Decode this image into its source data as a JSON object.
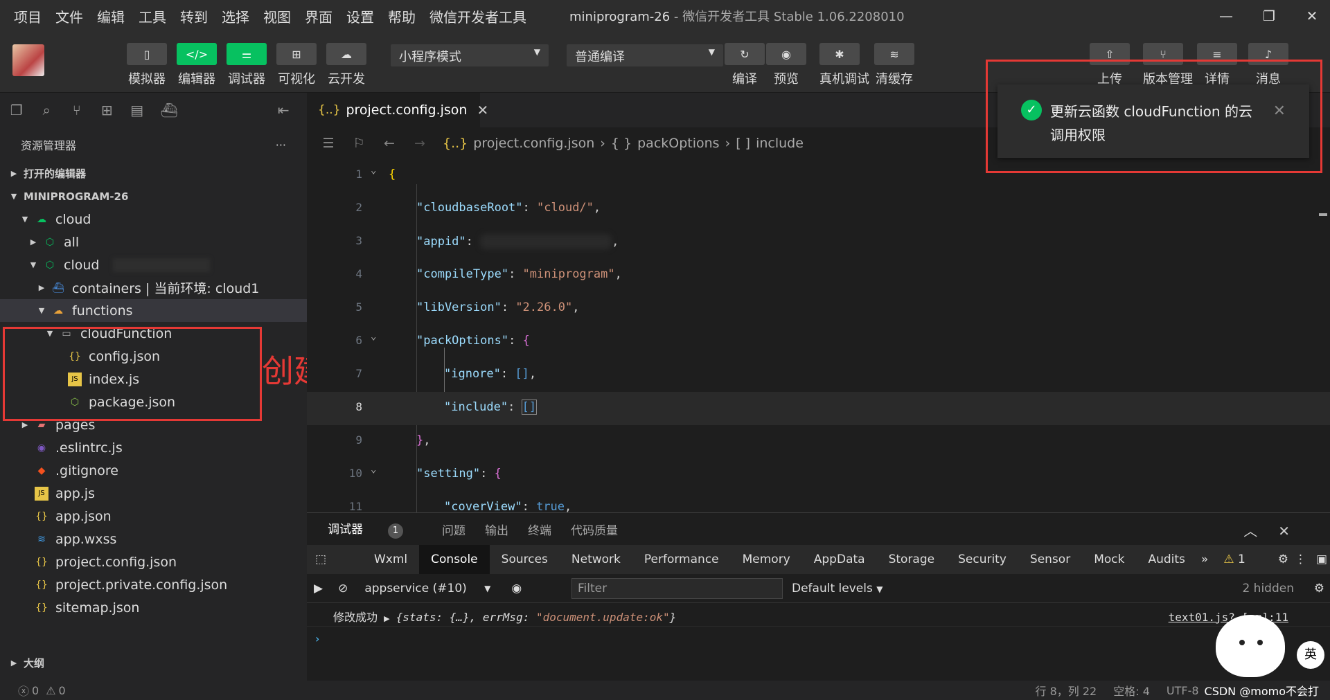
{
  "menubar": {
    "items": [
      "项目",
      "文件",
      "编辑",
      "工具",
      "转到",
      "选择",
      "视图",
      "界面",
      "设置",
      "帮助",
      "微信开发者工具"
    ],
    "title": "miniprogram-26",
    "title_suffix": " - 微信开发者工具 Stable 1.06.2208010"
  },
  "toolbar": {
    "simulator": "模拟器",
    "editor": "编辑器",
    "debugger": "调试器",
    "visual": "可视化",
    "cloud": "云开发",
    "mode_select": "小程序模式",
    "compile_select": "普通编译",
    "compile": "编译",
    "preview": "预览",
    "remote_debug": "真机调试",
    "clear_cache": "清缓存",
    "upload": "上传",
    "version": "版本管理",
    "details": "详情",
    "messages": "消息"
  },
  "sidebar": {
    "title": "资源管理器",
    "more": "···",
    "open_editors": "打开的编辑器",
    "project": "MINIPROGRAM-26",
    "tree": [
      {
        "label": "cloud"
      },
      {
        "label": "all"
      },
      {
        "label": "cloud"
      },
      {
        "label": "containers | 当前环境: cloud1"
      },
      {
        "label": "functions"
      },
      {
        "label": "cloudFunction"
      },
      {
        "label": "config.json"
      },
      {
        "label": "index.js"
      },
      {
        "label": "package.json"
      },
      {
        "label": "pages"
      },
      {
        "label": ".eslintrc.js"
      },
      {
        "label": ".gitignore"
      },
      {
        "label": "app.js"
      },
      {
        "label": "app.json"
      },
      {
        "label": "app.wxss"
      },
      {
        "label": "project.config.json"
      },
      {
        "label": "project.private.config.json"
      },
      {
        "label": "sitemap.json"
      }
    ],
    "outline": "大纲"
  },
  "annotation": "创建node.js云函数",
  "editor": {
    "tab": "project.config.json",
    "breadcrumb": [
      "project.config.json",
      "packOptions",
      "include"
    ],
    "lines": [
      {
        "n": "1"
      },
      {
        "n": "2"
      },
      {
        "n": "3"
      },
      {
        "n": "4"
      },
      {
        "n": "5"
      },
      {
        "n": "6"
      },
      {
        "n": "7"
      },
      {
        "n": "8"
      },
      {
        "n": "9"
      },
      {
        "n": "10"
      },
      {
        "n": "11"
      }
    ],
    "code": {
      "cloudbaseRoot_key": "\"cloudbaseRoot\"",
      "cloudbaseRoot_val": "\"cloud/\"",
      "appid_key": "\"appid\"",
      "compileType_key": "\"compileType\"",
      "compileType_val": "\"miniprogram\"",
      "libVersion_key": "\"libVersion\"",
      "libVersion_val": "\"2.26.0\"",
      "packOptions_key": "\"packOptions\"",
      "ignore_key": "\"ignore\"",
      "include_key": "\"include\"",
      "setting_key": "\"setting\"",
      "coverView_key": "\"coverView\"",
      "coverView_val": "true"
    }
  },
  "toast": {
    "message": "更新云函数 cloudFunction 的云调用权限"
  },
  "panel": {
    "tabs": [
      "调试器",
      "问题",
      "输出",
      "终端",
      "代码质量"
    ],
    "debugger_badge": "1",
    "devtools_tabs": [
      "Wxml",
      "Console",
      "Sources",
      "Network",
      "Performance",
      "Memory",
      "AppData",
      "Storage",
      "Security",
      "Sensor",
      "Mock",
      "Audits"
    ],
    "more_tabs": "»",
    "warnings": "1",
    "context": "appservice (#10)",
    "filter_placeholder": "Filter",
    "levels": "Default levels",
    "hidden": "2 hidden",
    "log_prefix": "修改成功",
    "log_obj": "{stats: {…}, errMsg: ",
    "log_str": "\"document.update:ok\"",
    "log_end": "}",
    "log_src": "text01.js? [sm]:11"
  },
  "status": {
    "errors": "0",
    "warnings": "0",
    "position": "行 8，列 22",
    "spaces": "空格: 4",
    "encoding": "UTF-8",
    "watermark": "CSDN @momo不会打"
  },
  "ime": "英"
}
